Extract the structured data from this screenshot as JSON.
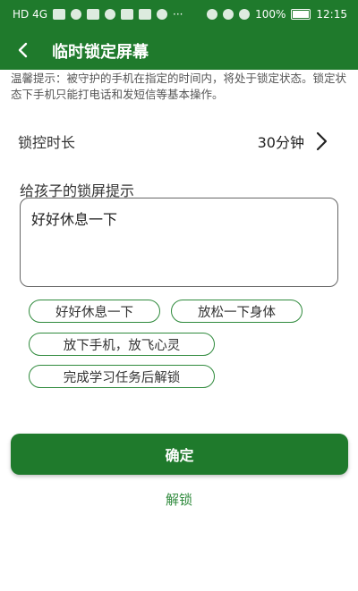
{
  "status_bar": {
    "left_text": "HD 4G",
    "battery": "100%",
    "time": "12:15"
  },
  "header": {
    "title": "临时锁定屏幕"
  },
  "tip": "温馨提示：被守护的手机在指定的时间内，将处于锁定状态。锁定状态下手机只能打电话和发短信等基本操作。",
  "duration": {
    "label": "锁控时长",
    "value": "30分钟"
  },
  "lock_message": {
    "label": "给孩子的锁屏提示",
    "value": "好好休息一下"
  },
  "chips": [
    "好好休息一下",
    "放松一下身体",
    "放下手机，放飞心灵",
    "完成学习任务后解锁"
  ],
  "actions": {
    "confirm_label": "确定",
    "unlock_label": "解锁"
  },
  "colors": {
    "primary": "#1f7a2c",
    "chip_border": "#2f8a3c"
  }
}
